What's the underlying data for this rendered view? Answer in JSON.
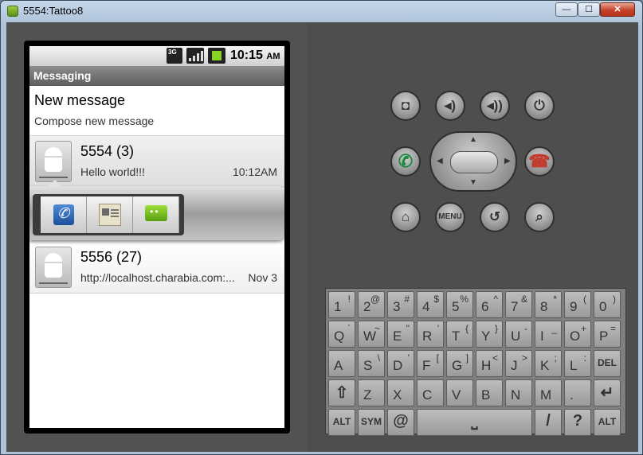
{
  "window": {
    "title": "5554:Tattoo8",
    "minimize": "—",
    "maximize": "☐",
    "close": "✕"
  },
  "status_bar": {
    "network": "3G",
    "time": "10:15",
    "ampm": "AM"
  },
  "app_bar": {
    "title": "Messaging"
  },
  "new_message": {
    "title": "New message",
    "subtitle": "Compose new message"
  },
  "threads": [
    {
      "name": "5554 (3)",
      "snippet": "Hello world!!!",
      "time": "10:12AM"
    },
    {
      "name": "5556 (27)",
      "snippet": "http://localhost.charabia.com:...",
      "time": "Nov 3"
    }
  ],
  "quick_contact": {
    "actions": [
      "call-icon",
      "contact-card-icon",
      "sms-icon"
    ]
  },
  "controls": {
    "menu_label": "MENU",
    "icons": [
      "camera-icon",
      "volume-down-icon",
      "volume-up-icon",
      "power-icon",
      "call-icon",
      "end-call-icon",
      "home-icon",
      "back-icon",
      "search-icon"
    ]
  },
  "keyboard": {
    "row1": [
      [
        "1",
        "!"
      ],
      [
        "2",
        "@"
      ],
      [
        "3",
        "#"
      ],
      [
        "4",
        "$"
      ],
      [
        "5",
        "%"
      ],
      [
        "6",
        "^"
      ],
      [
        "7",
        "&"
      ],
      [
        "8",
        "*"
      ],
      [
        "9",
        "("
      ],
      [
        "0",
        ")"
      ]
    ],
    "row2": [
      [
        "Q",
        "`"
      ],
      [
        "W",
        "~"
      ],
      [
        "E",
        "\""
      ],
      [
        "R",
        "'"
      ],
      [
        "T",
        "{"
      ],
      [
        "Y",
        "}"
      ],
      [
        "U",
        "-"
      ],
      [
        "I",
        "_"
      ],
      [
        "O",
        "+"
      ],
      [
        "P",
        "="
      ]
    ],
    "row3": [
      [
        "A",
        ""
      ],
      [
        "S",
        "\\"
      ],
      [
        "D",
        "'"
      ],
      [
        "F",
        "["
      ],
      [
        "G",
        "]"
      ],
      [
        "H",
        "<"
      ],
      [
        "J",
        ">"
      ],
      [
        "K",
        ";"
      ],
      [
        "L",
        ":"
      ]
    ],
    "row4": [
      [
        "Z",
        ""
      ],
      [
        "X",
        ""
      ],
      [
        "C",
        ""
      ],
      [
        "V",
        ""
      ],
      [
        "B",
        ""
      ],
      [
        "N",
        ""
      ],
      [
        "M",
        ""
      ],
      [
        ".",
        ""
      ]
    ],
    "row5": {
      "alt_left": "ALT",
      "sym": "SYM",
      "at": "@",
      "slash": "/",
      "question": "?",
      "alt_right": "ALT"
    },
    "del_label": "DEL"
  }
}
